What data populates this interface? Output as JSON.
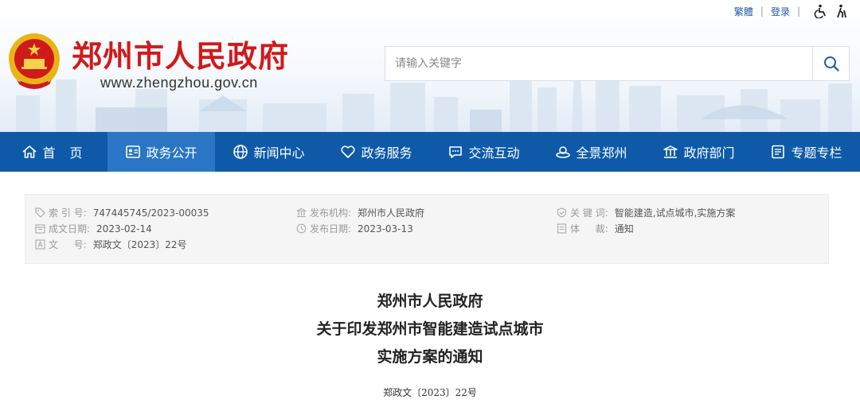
{
  "header": {
    "site_name": "郑州市人民政府",
    "site_url": "www.zhengzhou.gov.cn",
    "top_links": {
      "traditional": "繁體",
      "login": "登录"
    },
    "search": {
      "placeholder": "请输入关键字"
    }
  },
  "nav": {
    "items": [
      {
        "label": "首页",
        "icon": "home-icon"
      },
      {
        "label": "政务公开",
        "icon": "id-card-icon"
      },
      {
        "label": "新闻中心",
        "icon": "globe-icon"
      },
      {
        "label": "政务服务",
        "icon": "heart-icon"
      },
      {
        "label": "交流互动",
        "icon": "chat-icon"
      },
      {
        "label": "全景郑州",
        "icon": "panorama-icon"
      },
      {
        "label": "政府部门",
        "icon": "building-icon"
      },
      {
        "label": "专题专栏",
        "icon": "document-icon"
      }
    ],
    "active_index": 1
  },
  "meta": {
    "index_no": {
      "key": "索 引 号:",
      "value": "747445745/2023-00035"
    },
    "issuer": {
      "key": "发布机构:",
      "value": "郑州市人民政府"
    },
    "keywords": {
      "key": "关 键 词:",
      "value": "智能建造,试点城市,实施方案"
    },
    "created_date": {
      "key": "成文日期:",
      "value": "2023-02-14"
    },
    "publish_date": {
      "key": "发布日期:",
      "value": "2023-03-13"
    },
    "genre": {
      "key": "体 　 裁:",
      "value": "通知"
    },
    "doc_no": {
      "key": "文 　 号:",
      "value": "郑政文〔2023〕22号"
    }
  },
  "document": {
    "title_line1": "郑州市人民政府",
    "title_line2": "关于印发郑州市智能建造试点城市",
    "title_line3": "实施方案的通知",
    "doc_number": "郑政文〔2023〕22号"
  },
  "colors": {
    "brand_red": "#d01a1a",
    "nav_blue": "#0e5aa8",
    "nav_active": "#2a76c4",
    "link_blue": "#1f5aa6"
  }
}
